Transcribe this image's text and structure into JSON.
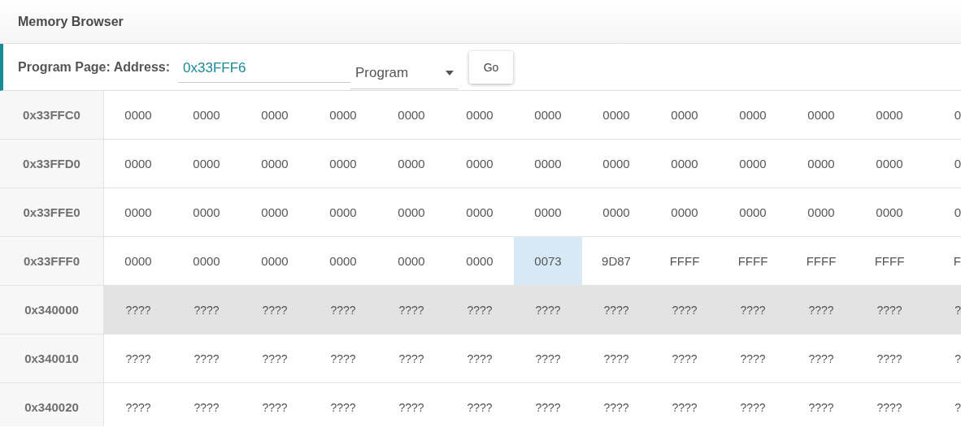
{
  "panel": {
    "title": "Memory Browser"
  },
  "toolbar": {
    "label": "Program Page: Address:",
    "address": {
      "value": "0x33FFF6"
    },
    "page_select": {
      "value": "Program"
    },
    "go_button": "Go"
  },
  "memory_rows": [
    {
      "address": "0x33FFC0",
      "selected": false,
      "cells": [
        {
          "text": "0000",
          "selected": false
        },
        {
          "text": "0000",
          "selected": false
        },
        {
          "text": "0000",
          "selected": false
        },
        {
          "text": "0000",
          "selected": false
        },
        {
          "text": "0000",
          "selected": false
        },
        {
          "text": "0000",
          "selected": false
        },
        {
          "text": "0000",
          "selected": false
        },
        {
          "text": "0000",
          "selected": false
        },
        {
          "text": "0000",
          "selected": false
        },
        {
          "text": "0000",
          "selected": false
        },
        {
          "text": "0000",
          "selected": false
        },
        {
          "text": "0000",
          "selected": false
        },
        {
          "text": "0",
          "selected": false
        }
      ]
    },
    {
      "address": "0x33FFD0",
      "selected": false,
      "cells": [
        {
          "text": "0000",
          "selected": false
        },
        {
          "text": "0000",
          "selected": false
        },
        {
          "text": "0000",
          "selected": false
        },
        {
          "text": "0000",
          "selected": false
        },
        {
          "text": "0000",
          "selected": false
        },
        {
          "text": "0000",
          "selected": false
        },
        {
          "text": "0000",
          "selected": false
        },
        {
          "text": "0000",
          "selected": false
        },
        {
          "text": "0000",
          "selected": false
        },
        {
          "text": "0000",
          "selected": false
        },
        {
          "text": "0000",
          "selected": false
        },
        {
          "text": "0000",
          "selected": false
        },
        {
          "text": "0",
          "selected": false
        }
      ]
    },
    {
      "address": "0x33FFE0",
      "selected": false,
      "cells": [
        {
          "text": "0000",
          "selected": false
        },
        {
          "text": "0000",
          "selected": false
        },
        {
          "text": "0000",
          "selected": false
        },
        {
          "text": "0000",
          "selected": false
        },
        {
          "text": "0000",
          "selected": false
        },
        {
          "text": "0000",
          "selected": false
        },
        {
          "text": "0000",
          "selected": false
        },
        {
          "text": "0000",
          "selected": false
        },
        {
          "text": "0000",
          "selected": false
        },
        {
          "text": "0000",
          "selected": false
        },
        {
          "text": "0000",
          "selected": false
        },
        {
          "text": "0000",
          "selected": false
        },
        {
          "text": "0",
          "selected": false
        }
      ]
    },
    {
      "address": "0x33FFF0",
      "selected": false,
      "cells": [
        {
          "text": "0000",
          "selected": false
        },
        {
          "text": "0000",
          "selected": false
        },
        {
          "text": "0000",
          "selected": false
        },
        {
          "text": "0000",
          "selected": false
        },
        {
          "text": "0000",
          "selected": false
        },
        {
          "text": "0000",
          "selected": false
        },
        {
          "text": "0073",
          "selected": true
        },
        {
          "text": "9D87",
          "selected": false
        },
        {
          "text": "FFFF",
          "selected": false
        },
        {
          "text": "FFFF",
          "selected": false
        },
        {
          "text": "FFFF",
          "selected": false
        },
        {
          "text": "FFFF",
          "selected": false
        },
        {
          "text": "F",
          "selected": false
        }
      ]
    },
    {
      "address": "0x340000",
      "selected": true,
      "cells": [
        {
          "text": "????",
          "selected": false
        },
        {
          "text": "????",
          "selected": false
        },
        {
          "text": "????",
          "selected": false
        },
        {
          "text": "????",
          "selected": false
        },
        {
          "text": "????",
          "selected": false
        },
        {
          "text": "????",
          "selected": false
        },
        {
          "text": "????",
          "selected": false
        },
        {
          "text": "????",
          "selected": false
        },
        {
          "text": "????",
          "selected": false
        },
        {
          "text": "????",
          "selected": false
        },
        {
          "text": "????",
          "selected": false
        },
        {
          "text": "????",
          "selected": false
        },
        {
          "text": "?",
          "selected": false
        }
      ]
    },
    {
      "address": "0x340010",
      "selected": false,
      "cells": [
        {
          "text": "????",
          "selected": false
        },
        {
          "text": "????",
          "selected": false
        },
        {
          "text": "????",
          "selected": false
        },
        {
          "text": "????",
          "selected": false
        },
        {
          "text": "????",
          "selected": false
        },
        {
          "text": "????",
          "selected": false
        },
        {
          "text": "????",
          "selected": false
        },
        {
          "text": "????",
          "selected": false
        },
        {
          "text": "????",
          "selected": false
        },
        {
          "text": "????",
          "selected": false
        },
        {
          "text": "????",
          "selected": false
        },
        {
          "text": "????",
          "selected": false
        },
        {
          "text": "?",
          "selected": false
        }
      ]
    },
    {
      "address": "0x340020",
      "selected": false,
      "cells": [
        {
          "text": "????",
          "selected": false
        },
        {
          "text": "????",
          "selected": false
        },
        {
          "text": "????",
          "selected": false
        },
        {
          "text": "????",
          "selected": false
        },
        {
          "text": "????",
          "selected": false
        },
        {
          "text": "????",
          "selected": false
        },
        {
          "text": "????",
          "selected": false
        },
        {
          "text": "????",
          "selected": false
        },
        {
          "text": "????",
          "selected": false
        },
        {
          "text": "????",
          "selected": false
        },
        {
          "text": "????",
          "selected": false
        },
        {
          "text": "????",
          "selected": false
        },
        {
          "text": "?",
          "selected": false
        }
      ]
    }
  ]
}
